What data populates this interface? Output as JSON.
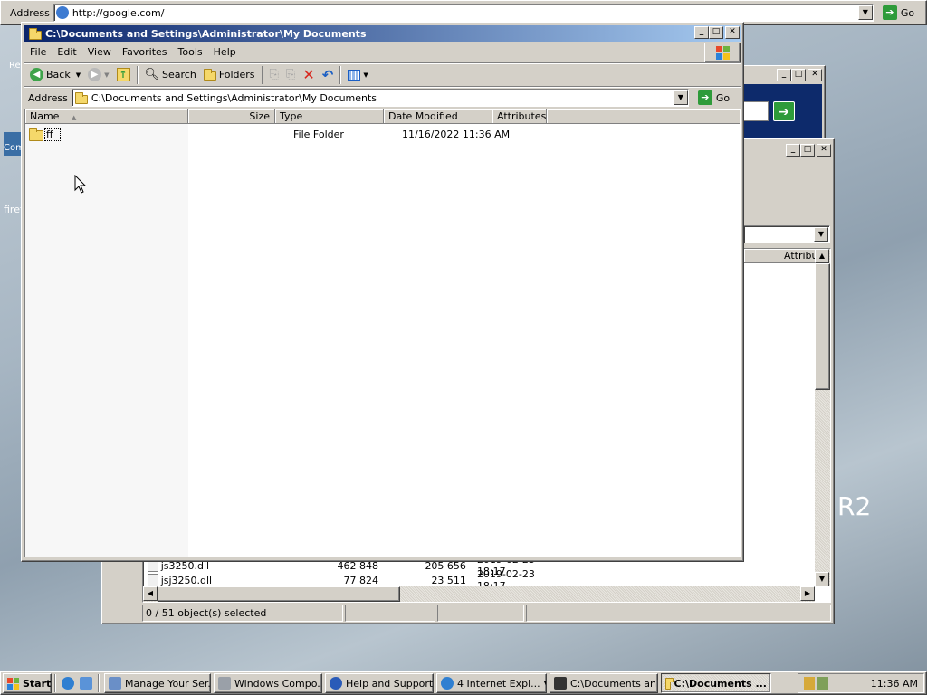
{
  "browser_bar": {
    "address_label": "Address",
    "url": "http://google.com/",
    "go_label": "Go"
  },
  "desktop": {
    "icon_labels": [
      "Re",
      "Com",
      "firef"
    ],
    "watermark": "R2"
  },
  "main_window": {
    "title": "C:\\Documents and Settings\\Administrator\\My Documents",
    "menu": [
      "File",
      "Edit",
      "View",
      "Favorites",
      "Tools",
      "Help"
    ],
    "toolbar": {
      "back": "Back",
      "search": "Search",
      "folders": "Folders"
    },
    "address_label": "Address",
    "address": "C:\\Documents and Settings\\Administrator\\My Documents",
    "go_label": "Go",
    "columns": [
      "Name",
      "Size",
      "Type",
      "Date Modified",
      "Attributes"
    ],
    "files": [
      {
        "name": "ff",
        "size": "",
        "type": "File Folder",
        "modified": "11/16/2022 11:36 AM",
        "attributes": ""
      }
    ]
  },
  "back_window": {
    "column_visible": "Attribu",
    "rows": [
      {
        "name": "js3250.dll",
        "size": "462 848",
        "packed": "205 656",
        "date": "2019-02-23 18:17"
      },
      {
        "name": "jsj3250.dll",
        "size": "77 824",
        "packed": "23 511",
        "date": "2019-02-23 18:17"
      }
    ],
    "status": "0 / 51 object(s) selected"
  },
  "taskbar": {
    "start": "Start",
    "tasks": [
      {
        "label": "Manage Your Ser...",
        "color": "#6a8fc7"
      },
      {
        "label": "Windows Compo...",
        "color": "#9aa0a8"
      },
      {
        "label": "Help and Support...",
        "color": "#2a5bb8"
      },
      {
        "label": "4 Internet Expl...",
        "color": "#2f7fd1"
      },
      {
        "label": "C:\\Documents an...",
        "color": "#333333"
      },
      {
        "label": "C:\\Documents ...",
        "color": "#e8c34a"
      }
    ],
    "clock": "11:36 AM"
  }
}
